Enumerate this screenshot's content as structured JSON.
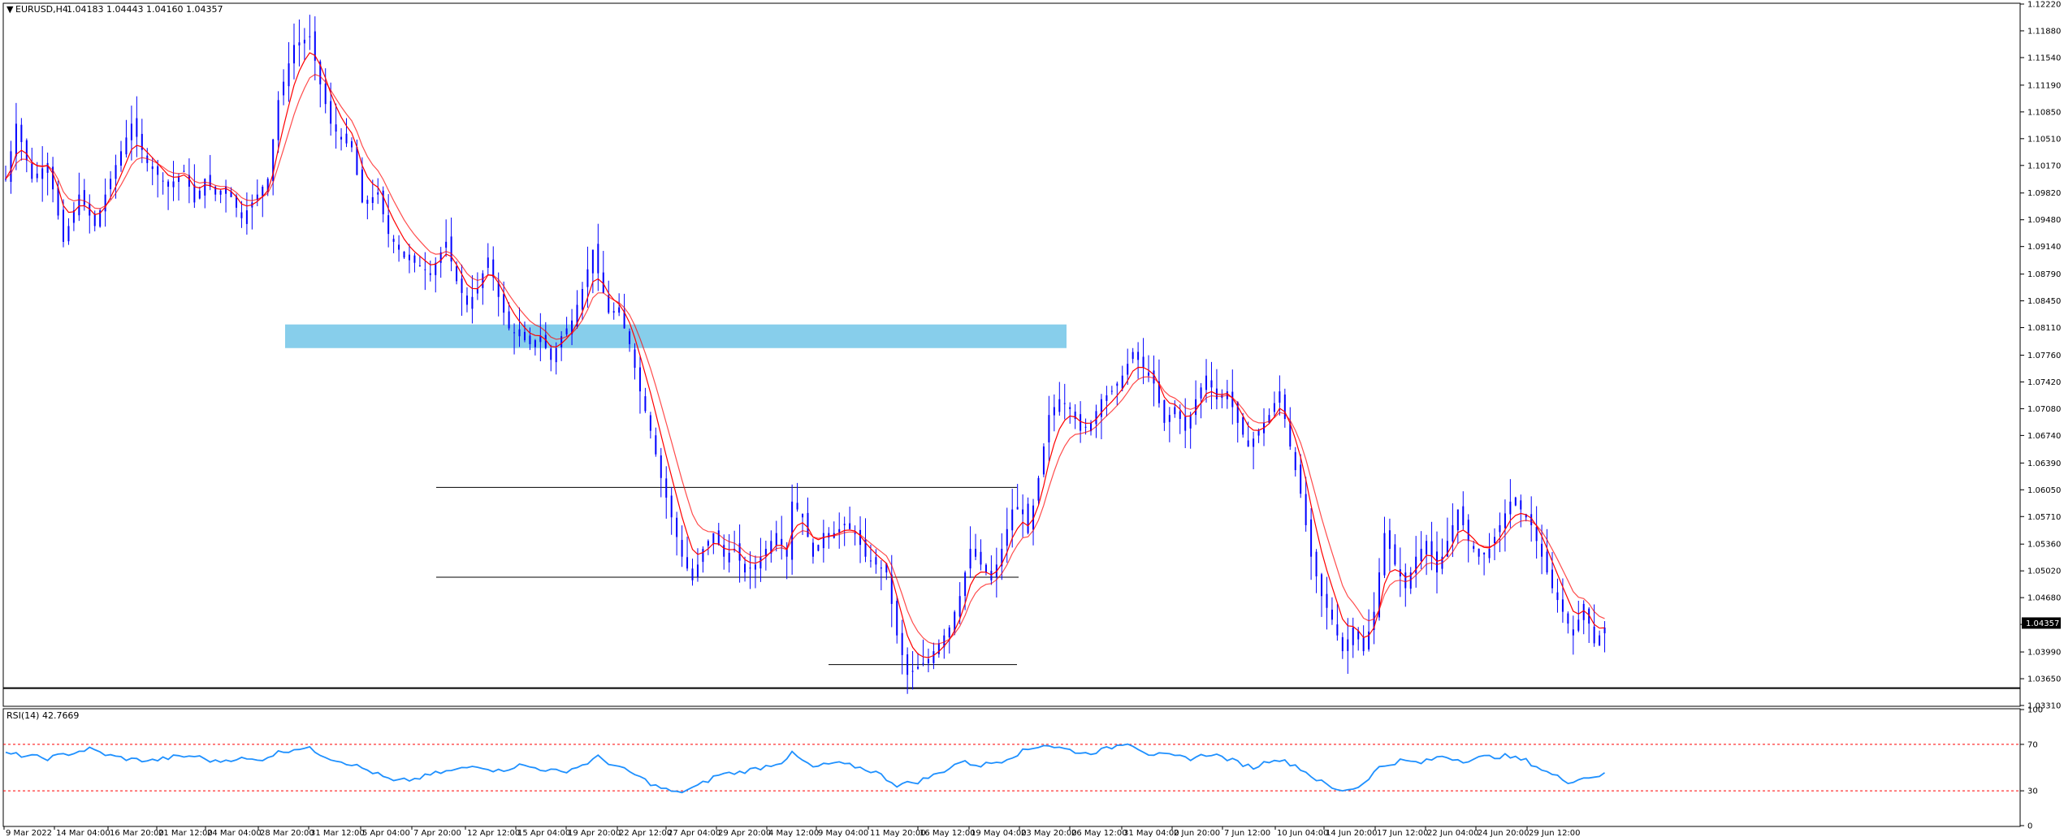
{
  "header": {
    "symbol_label": "EURUSD,H4",
    "ohlc": "1.04183 1.04443 1.04160 1.04357",
    "menu_glyph": "▼"
  },
  "rsi_panel": {
    "label": "RSI(14) 42.7669"
  },
  "colors": {
    "bull": "#0000ff",
    "bear": "#0000ff",
    "ma_fast": "#ff0000",
    "ma_slow": "#ff0000",
    "rsi_line": "#1e90ff",
    "zone": "#87ceeb",
    "level_line": "#000000",
    "rsi_level": "#ff0000"
  },
  "chart_data": [
    {
      "type": "candlestick",
      "title": "",
      "ylim": [
        1.0331,
        1.1222
      ],
      "price_ticks": [
        "1.12220",
        "1.11880",
        "1.11540",
        "1.11190",
        "1.10850",
        "1.10510",
        "1.10170",
        "1.09820",
        "1.09480",
        "1.09140",
        "1.08790",
        "1.08450",
        "1.08110",
        "1.07760",
        "1.07420",
        "1.07080",
        "1.06740",
        "1.06390",
        "1.06050",
        "1.05710",
        "1.05360",
        "1.05020",
        "1.04680",
        "1.04340",
        "1.03990",
        "1.03650",
        "1.03310"
      ],
      "tick_values": [
        1.1222,
        1.1188,
        1.1154,
        1.1119,
        1.1085,
        1.1051,
        1.1017,
        1.0982,
        1.0948,
        1.0914,
        1.0879,
        1.0845,
        1.0811,
        1.0776,
        1.0742,
        1.0708,
        1.0674,
        1.0639,
        1.0605,
        1.0571,
        1.0536,
        1.0502,
        1.0468,
        1.0434,
        1.0399,
        1.0365,
        1.0331
      ],
      "current_price": "1.04357",
      "time_labels": [
        "9 Mar 2022",
        "14 Mar 04:00",
        "16 Mar 20:00",
        "21 Mar 12:00",
        "24 Mar 04:00",
        "28 Mar 20:00",
        "31 Mar 12:00",
        "5 Apr 04:00",
        "7 Apr 20:00",
        "12 Apr 12:00",
        "15 Apr 04:00",
        "19 Apr 20:00",
        "22 Apr 12:00",
        "27 Apr 04:00",
        "29 Apr 20:00",
        "4 May 12:00",
        "9 May 04:00",
        "11 May 20:00",
        "16 May 12:00",
        "19 May 04:00",
        "23 May 20:00",
        "26 May 12:00",
        "31 May 04:00",
        "2 Jun 20:00",
        "7 Jun 12:00",
        "10 Jun 04:00",
        "14 Jun 20:00",
        "17 Jun 12:00",
        "22 Jun 04:00",
        "24 Jun 20:00",
        "29 Jun 12:00"
      ],
      "bar_count": 195,
      "price_path": [
        [
          0,
          1.1
        ],
        [
          2,
          1.107
        ],
        [
          5,
          1.1
        ],
        [
          8,
          1.102
        ],
        [
          11,
          1.092
        ],
        [
          14,
          1.098
        ],
        [
          17,
          1.094
        ],
        [
          20,
          1.1
        ],
        [
          24,
          1.107
        ],
        [
          27,
          1.102
        ],
        [
          31,
          1.099
        ],
        [
          34,
          1.101
        ],
        [
          36,
          1.097
        ],
        [
          38,
          1.1
        ],
        [
          40,
          1.098
        ],
        [
          42,
          1.099
        ],
        [
          45,
          1.095
        ],
        [
          48,
          1.098
        ],
        [
          50,
          1.1
        ],
        [
          52,
          1.11
        ],
        [
          55,
          1.117
        ],
        [
          58,
          1.118
        ],
        [
          60,
          1.112
        ],
        [
          62,
          1.107
        ],
        [
          64,
          1.105
        ],
        [
          66,
          1.104
        ],
        [
          68,
          1.097
        ],
        [
          71,
          1.098
        ],
        [
          73,
          1.093
        ],
        [
          76,
          1.09
        ],
        [
          79,
          1.089
        ],
        [
          81,
          1.088
        ],
        [
          84,
          1.092
        ],
        [
          86,
          1.087
        ],
        [
          88,
          1.084
        ],
        [
          90,
          1.086
        ],
        [
          92,
          1.09
        ],
        [
          94,
          1.085
        ],
        [
          96,
          1.081
        ],
        [
          98,
          1.08
        ],
        [
          100,
          1.079
        ],
        [
          102,
          1.08
        ],
        [
          104,
          1.077
        ],
        [
          106,
          1.08
        ],
        [
          108,
          1.082
        ],
        [
          110,
          1.086
        ],
        [
          112,
          1.091
        ],
        [
          113,
          1.088
        ],
        [
          115,
          1.083
        ],
        [
          117,
          1.083
        ],
        [
          119,
          1.079
        ],
        [
          121,
          1.073
        ],
        [
          123,
          1.068
        ],
        [
          125,
          1.062
        ],
        [
          127,
          1.057
        ],
        [
          129,
          1.052
        ],
        [
          131,
          1.049
        ],
        [
          133,
          1.053
        ],
        [
          135,
          1.055
        ],
        [
          137,
          1.052
        ],
        [
          139,
          1.053
        ],
        [
          141,
          1.05
        ],
        [
          143,
          1.051
        ],
        [
          145,
          1.053
        ],
        [
          147,
          1.055
        ],
        [
          149,
          1.052
        ],
        [
          150,
          1.059
        ],
        [
          152,
          1.057
        ],
        [
          154,
          1.052
        ],
        [
          156,
          1.055
        ],
        [
          158,
          1.055
        ],
        [
          160,
          1.056
        ],
        [
          162,
          1.055
        ],
        [
          164,
          1.052
        ],
        [
          166,
          1.051
        ],
        [
          168,
          1.05
        ],
        [
          170,
          1.042
        ],
        [
          172,
          1.037
        ],
        [
          174,
          1.038
        ],
        [
          176,
          1.039
        ],
        [
          178,
          1.041
        ],
        [
          180,
          1.043
        ],
        [
          182,
          1.047
        ],
        [
          184,
          1.053
        ],
        [
          186,
          1.051
        ],
        [
          188,
          1.049
        ],
        [
          190,
          1.053
        ],
        [
          192,
          1.058
        ],
        [
          194,
          1.058
        ],
        [
          195,
          1.055
        ],
        [
          197,
          1.062
        ],
        [
          199,
          1.07
        ],
        [
          201,
          1.072
        ],
        [
          203,
          1.071
        ],
        [
          205,
          1.068
        ],
        [
          207,
          1.069
        ],
        [
          209,
          1.072
        ],
        [
          211,
          1.073
        ],
        [
          213,
          1.075
        ],
        [
          215,
          1.078
        ],
        [
          217,
          1.076
        ],
        [
          219,
          1.074
        ],
        [
          221,
          1.069
        ],
        [
          223,
          1.071
        ],
        [
          225,
          1.068
        ],
        [
          227,
          1.072
        ],
        [
          229,
          1.075
        ],
        [
          231,
          1.072
        ],
        [
          233,
          1.073
        ],
        [
          235,
          1.069
        ],
        [
          237,
          1.066
        ],
        [
          239,
          1.068
        ],
        [
          241,
          1.07
        ],
        [
          243,
          1.073
        ],
        [
          245,
          1.066
        ],
        [
          247,
          1.06
        ],
        [
          249,
          1.052
        ],
        [
          251,
          1.047
        ],
        [
          253,
          1.044
        ],
        [
          255,
          1.04
        ],
        [
          257,
          1.043
        ],
        [
          259,
          1.04
        ],
        [
          261,
          1.045
        ],
        [
          263,
          1.055
        ],
        [
          265,
          1.051
        ],
        [
          267,
          1.048
        ],
        [
          269,
          1.052
        ],
        [
          271,
          1.054
        ],
        [
          273,
          1.05
        ],
        [
          275,
          1.054
        ],
        [
          277,
          1.058
        ],
        [
          279,
          1.054
        ],
        [
          281,
          1.052
        ],
        [
          283,
          1.053
        ],
        [
          285,
          1.056
        ],
        [
          287,
          1.059
        ],
        [
          289,
          1.058
        ],
        [
          291,
          1.056
        ],
        [
          293,
          1.052
        ],
        [
          295,
          1.048
        ],
        [
          297,
          1.045
        ],
        [
          299,
          1.042
        ],
        [
          301,
          1.046
        ],
        [
          303,
          1.041
        ],
        [
          305,
          1.043
        ]
      ],
      "support_zone": {
        "from": 1.0785,
        "to": 1.0815
      },
      "horizontal_levels": [
        1.0608,
        1.0494,
        1.0383,
        1.0353
      ],
      "series": [
        {
          "kind": "candles"
        },
        {
          "kind": "ma_fast"
        },
        {
          "kind": "ma_slow"
        }
      ]
    },
    {
      "type": "line",
      "title": "",
      "ylim": [
        0,
        100
      ],
      "ticks": [
        "100",
        "70",
        "30",
        "0"
      ],
      "tick_values": [
        100,
        70,
        30,
        0
      ],
      "levels": [
        70,
        30
      ],
      "rsi_path": [
        [
          0,
          62
        ],
        [
          4,
          60
        ],
        [
          8,
          58
        ],
        [
          12,
          62
        ],
        [
          16,
          66
        ],
        [
          20,
          60
        ],
        [
          24,
          57
        ],
        [
          28,
          56
        ],
        [
          32,
          59
        ],
        [
          36,
          60
        ],
        [
          40,
          55
        ],
        [
          44,
          58
        ],
        [
          48,
          56
        ],
        [
          52,
          63
        ],
        [
          56,
          67
        ],
        [
          58,
          66
        ],
        [
          62,
          58
        ],
        [
          66,
          53
        ],
        [
          70,
          46
        ],
        [
          74,
          38
        ],
        [
          78,
          40
        ],
        [
          82,
          45
        ],
        [
          86,
          48
        ],
        [
          90,
          52
        ],
        [
          94,
          47
        ],
        [
          98,
          52
        ],
        [
          102,
          49
        ],
        [
          106,
          46
        ],
        [
          110,
          52
        ],
        [
          113,
          59
        ],
        [
          116,
          52
        ],
        [
          120,
          44
        ],
        [
          124,
          34
        ],
        [
          128,
          28
        ],
        [
          132,
          34
        ],
        [
          136,
          44
        ],
        [
          140,
          46
        ],
        [
          144,
          50
        ],
        [
          148,
          55
        ],
        [
          150,
          62
        ],
        [
          154,
          50
        ],
        [
          158,
          54
        ],
        [
          162,
          51
        ],
        [
          166,
          46
        ],
        [
          170,
          35
        ],
        [
          174,
          38
        ],
        [
          178,
          45
        ],
        [
          182,
          55
        ],
        [
          186,
          52
        ],
        [
          190,
          56
        ],
        [
          194,
          64
        ],
        [
          198,
          70
        ],
        [
          202,
          66
        ],
        [
          206,
          62
        ],
        [
          210,
          66
        ],
        [
          214,
          72
        ],
        [
          218,
          62
        ],
        [
          222,
          60
        ],
        [
          226,
          58
        ],
        [
          230,
          62
        ],
        [
          234,
          56
        ],
        [
          238,
          50
        ],
        [
          242,
          58
        ],
        [
          246,
          52
        ],
        [
          250,
          40
        ],
        [
          254,
          30
        ],
        [
          258,
          33
        ],
        [
          262,
          50
        ],
        [
          266,
          56
        ],
        [
          270,
          54
        ],
        [
          274,
          60
        ],
        [
          278,
          56
        ],
        [
          282,
          59
        ],
        [
          286,
          60
        ],
        [
          290,
          56
        ],
        [
          294,
          46
        ],
        [
          298,
          38
        ],
        [
          302,
          42
        ],
        [
          305,
          44
        ]
      ]
    }
  ]
}
